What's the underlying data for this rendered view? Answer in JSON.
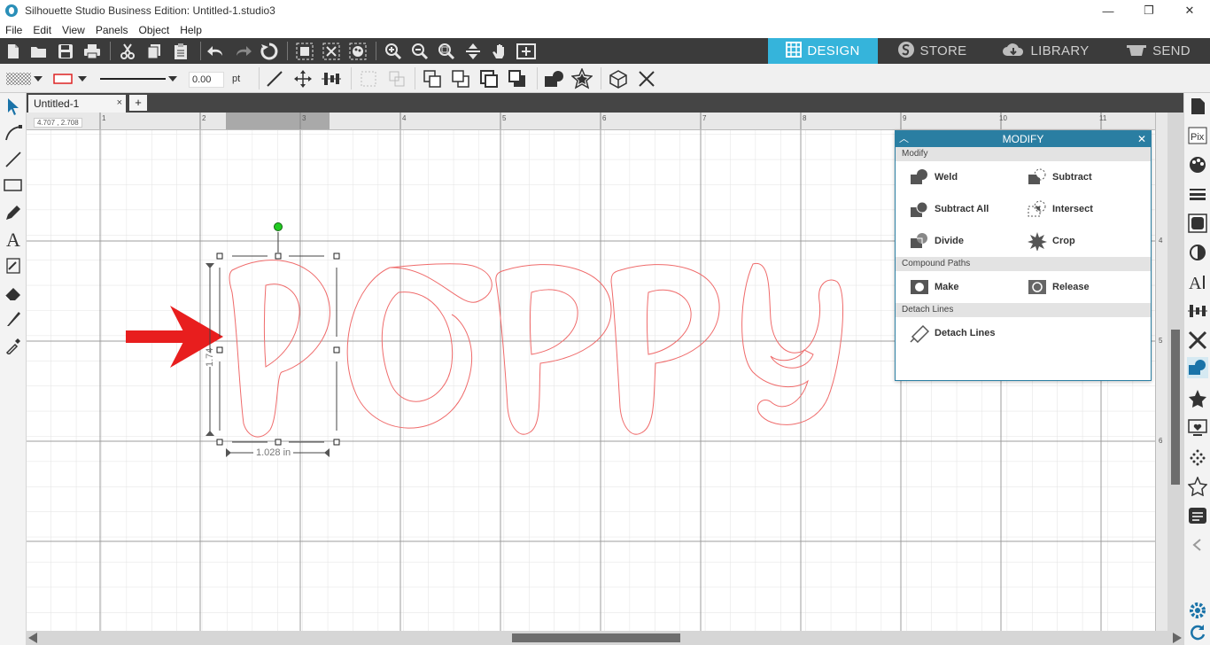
{
  "window": {
    "title": "Silhouette Studio Business Edition: Untitled-1.studio3",
    "minimize": "—",
    "restore": "❐",
    "close": "✕"
  },
  "menu": [
    "File",
    "Edit",
    "View",
    "Panels",
    "Object",
    "Help"
  ],
  "tabs": {
    "design": "DESIGN",
    "store": "STORE",
    "library": "LIBRARY",
    "send": "SEND"
  },
  "toolbar2": {
    "line_weight": "0.00",
    "line_unit": "pt"
  },
  "document": {
    "tab_name": "Untitled-1",
    "tab_close": "×",
    "add_tab": "+"
  },
  "ruler": {
    "coords": "4.707 , 2.708",
    "h_ticks": [
      "1",
      "2",
      "3",
      "4",
      "5",
      "6",
      "7",
      "8",
      "9",
      "10",
      "11"
    ],
    "v_ticks": [
      "4",
      "5",
      "6"
    ]
  },
  "selection": {
    "width_label": "1.028 in",
    "height_label": "1.74"
  },
  "design_text": "Poppy",
  "modify_panel": {
    "title": "MODIFY",
    "collapse": "︿",
    "close": "✕",
    "section_modify": "Modify",
    "weld": "Weld",
    "subtract": "Subtract",
    "subtract_all": "Subtract All",
    "intersect": "Intersect",
    "divide": "Divide",
    "crop": "Crop",
    "section_compound": "Compound Paths",
    "make": "Make",
    "release": "Release",
    "section_detach": "Detach Lines",
    "detach_lines": "Detach Lines"
  },
  "colors": {
    "accent": "#35b4db",
    "panel_header": "#2a7ea2",
    "outline": "#ef6b6b",
    "arrow": "#e81e1e"
  }
}
